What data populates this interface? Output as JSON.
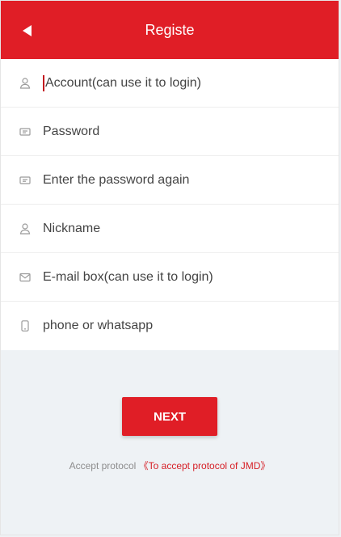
{
  "header": {
    "title": "Registe"
  },
  "form": {
    "fields": [
      {
        "icon": "user-icon",
        "placeholder": "Account(can use it to login)",
        "focused": true
      },
      {
        "icon": "password-icon",
        "placeholder": "Password"
      },
      {
        "icon": "password-icon",
        "placeholder": "Enter the password again"
      },
      {
        "icon": "user-icon",
        "placeholder": "Nickname"
      },
      {
        "icon": "mail-icon",
        "placeholder": "E-mail box(can use it to login)"
      },
      {
        "icon": "phone-icon",
        "placeholder": "phone or whatsapp"
      }
    ]
  },
  "actions": {
    "next_label": "NEXT"
  },
  "protocol": {
    "prefix": "Accept protocol",
    "link": "《To accept protocol of JMD》"
  },
  "colors": {
    "brand_red": "#e01e26",
    "background": "#eef2f5",
    "icon_gray": "#9a9a9a"
  }
}
